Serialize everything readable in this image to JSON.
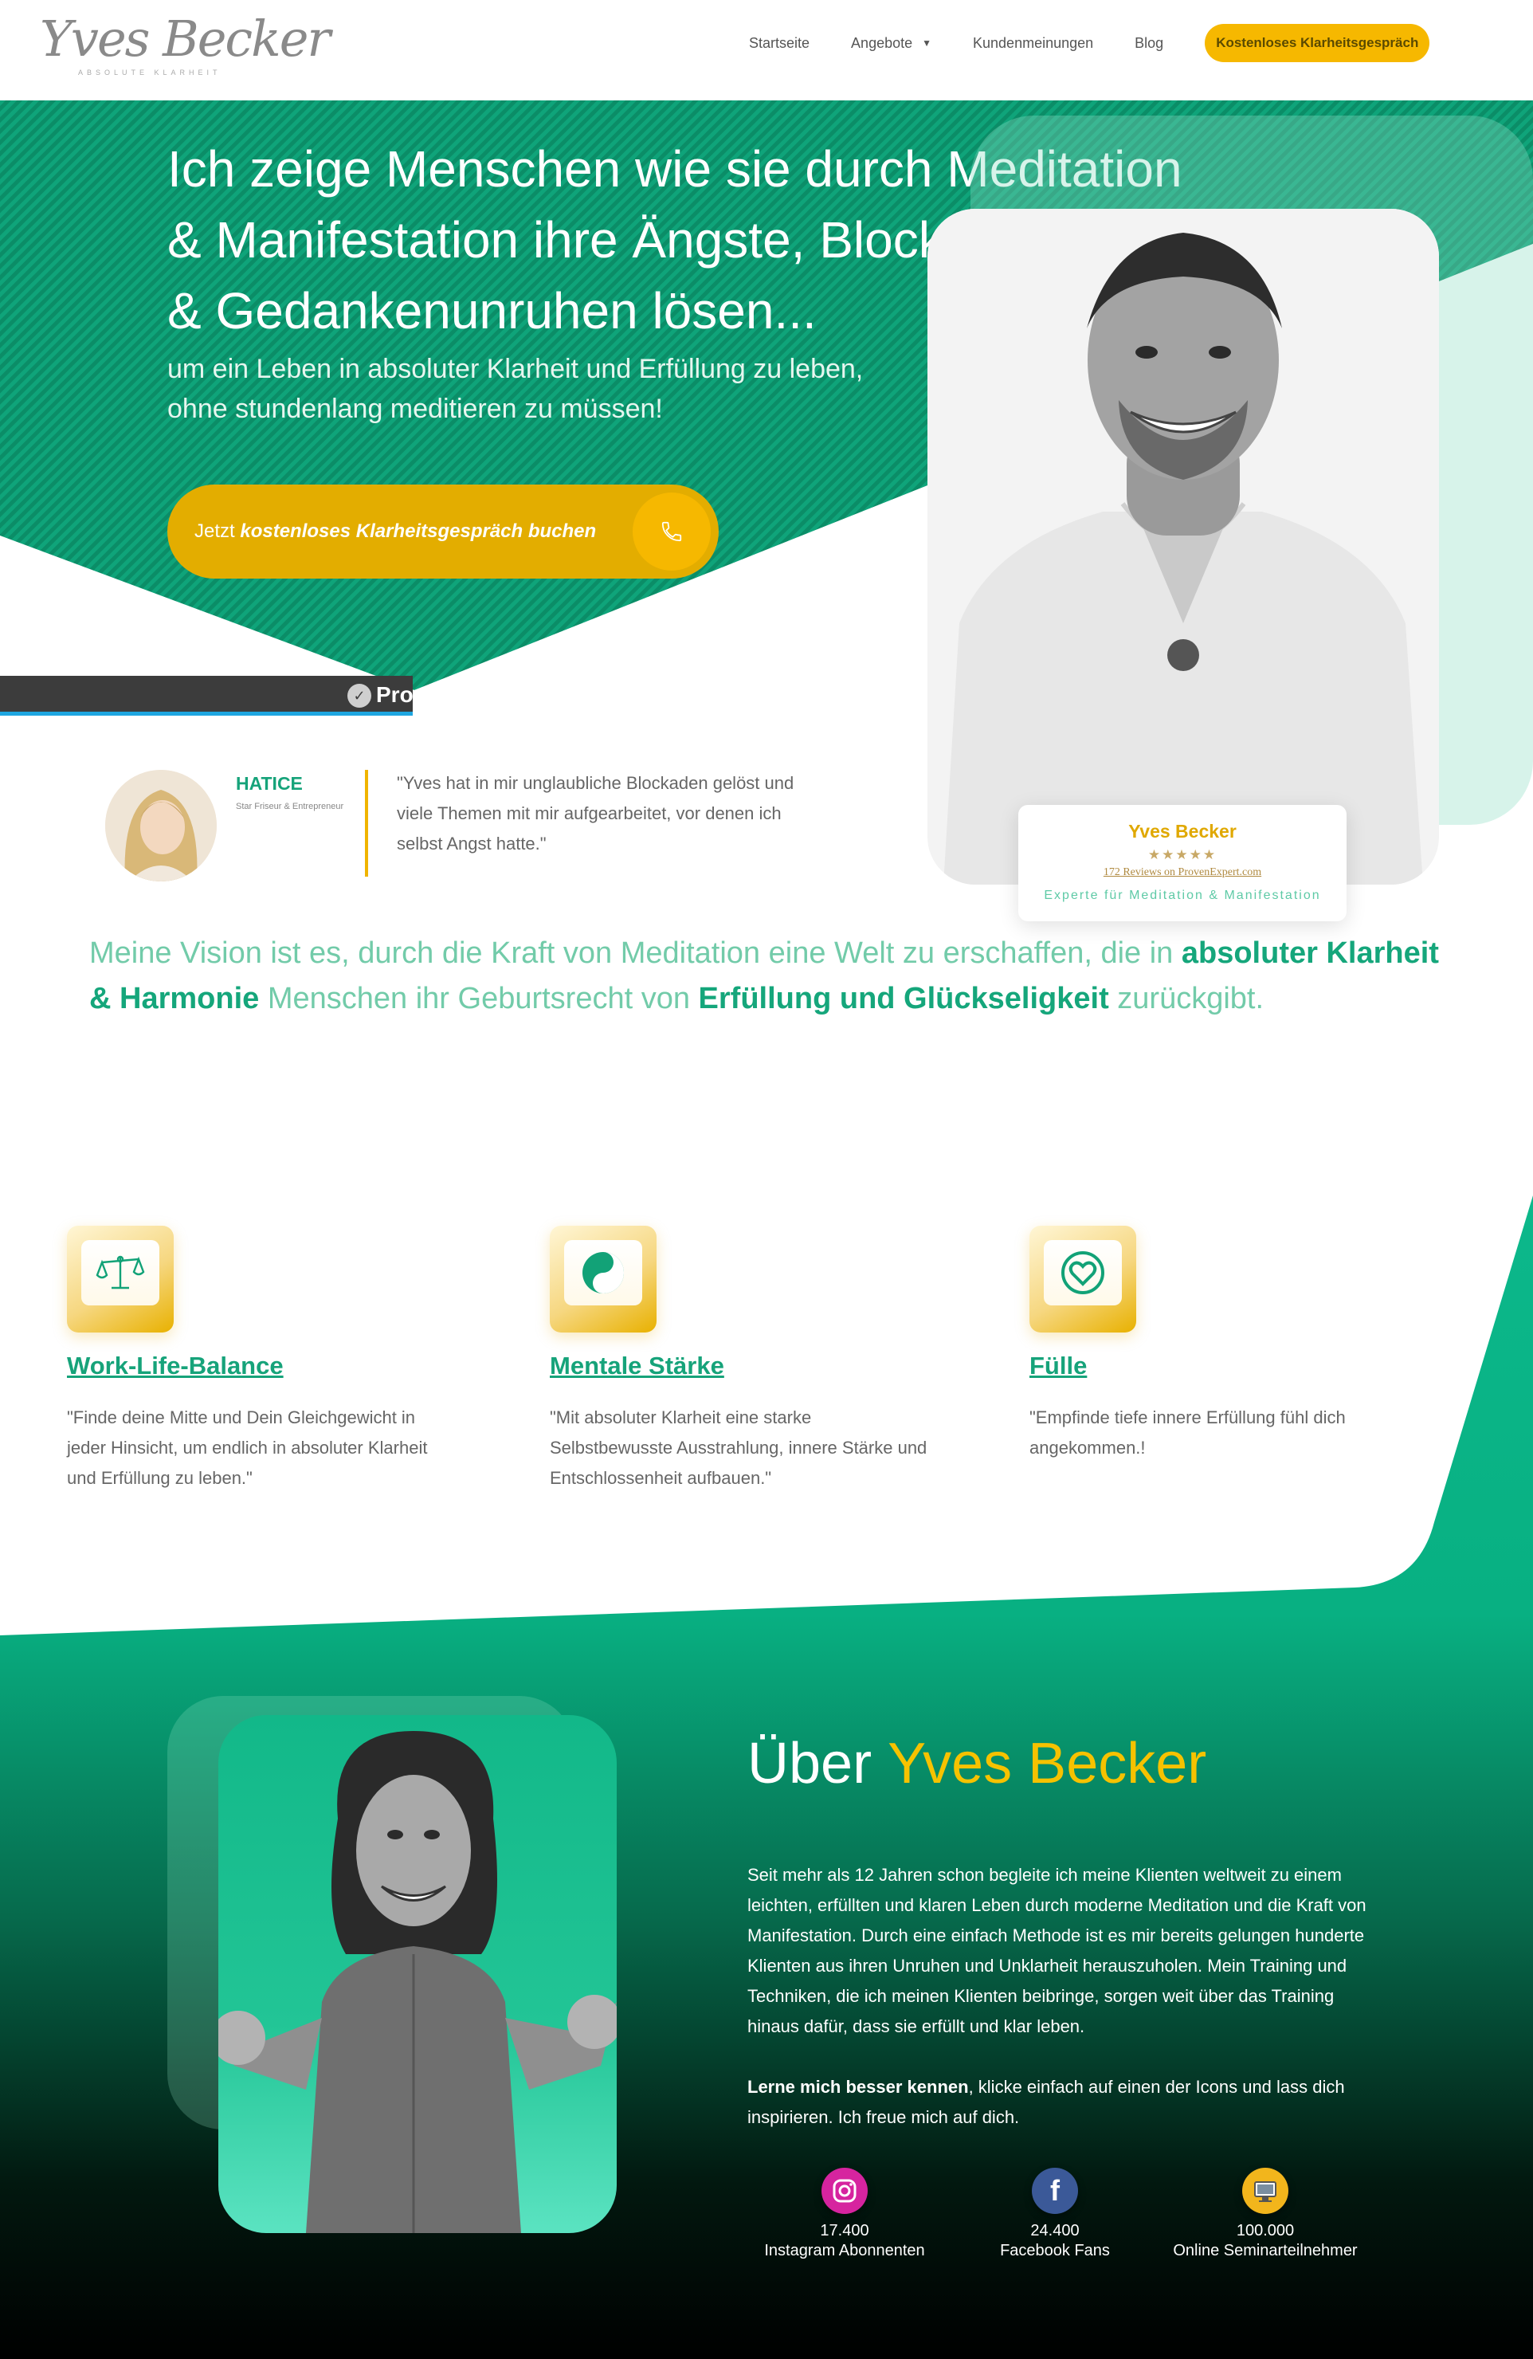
{
  "header": {
    "logo_name": "Yves Becker",
    "logo_tagline": "ABSOLUTE KLARHEIT",
    "nav": [
      "Startseite",
      "Angebote",
      "Kundenmeinungen",
      "Blog"
    ],
    "cta": "Kostenloses Klarheitsgespräch"
  },
  "hero": {
    "title": "Ich zeige Menschen wie sie durch Meditation & Manifestation ihre Ängste, Blockaden Stress & Gedankenunruhen lösen...",
    "subtitle_line1": "um ein Leben in absoluter Klarheit und Erfüllung zu leben,",
    "subtitle_line2": "ohne stundenlang meditieren zu müssen!",
    "cta_prefix": "Jetzt",
    "cta_bold": "kostenloses Klarheitsgespräch buchen",
    "phone_icon": "phone-icon"
  },
  "proven_expert": {
    "bar_text": "Pro",
    "card_name": "Yves Becker",
    "stars": "★★★★★",
    "reviews": "172 Reviews on ProvenExpert.com",
    "role": "Experte für Meditation & Manifestation"
  },
  "testimonial": {
    "name": "HATICE",
    "role": "Star Friseur & Entrepreneur",
    "quote": "\"Yves hat in mir unglaubliche Blockaden gelöst und viele Themen mit mir aufgearbeitet, vor denen ich selbst Angst hatte.\""
  },
  "vision": {
    "part1": "Meine Vision ist es, durch die Kraft von Meditation eine Welt zu erschaffen, die in ",
    "bold1": "absoluter Klarheit & Harmonie",
    "part2": " Menschen ihr Geburtsrecht von ",
    "bold2": "Erfüllung und Glückseligkeit",
    "part3": " zurückgibt."
  },
  "features": [
    {
      "title": "Work-Life-Balance",
      "text": "\"Finde deine Mitte und Dein Gleichgewicht in jeder Hinsicht, um endlich in absoluter Klarheit und Erfüllung zu leben.\"",
      "icon": "scales-icon"
    },
    {
      "title": "Mentale Stärke",
      "text": "\"Mit absoluter Klarheit eine starke Selbstbewusste Ausstrahlung, innere Stärke und Entschlossenheit aufbauen.\"",
      "icon": "yin-yang-icon"
    },
    {
      "title": "Fülle",
      "text": "\"Empfinde tiefe innere Erfüllung fühl dich angekommen.!",
      "icon": "heart-icon"
    }
  ],
  "about": {
    "title_prefix": "Über",
    "title_name": "Yves Becker",
    "text": "Seit mehr als 12 Jahren schon begleite ich meine Klienten weltweit zu einem leichten, erfüllten und klaren Leben durch moderne Meditation und die Kraft von Manifestation. Durch eine einfach Methode ist es mir bereits gelungen hunderte Klienten aus ihren Unruhen und Unklarheit herauszuholen. Mein Training und Techniken, die ich meinen Klienten beibringe, sorgen weit über das Training hinaus dafür, dass sie erfüllt und klar leben.",
    "text2_bold": "Lerne mich besser kennen",
    "text2_rest": ", klicke einfach auf einen der Icons und lass dich inspirieren. Ich freue mich auf dich."
  },
  "stats": [
    {
      "number": "17.400",
      "label": "Instagram Abonnenten",
      "icon": "instagram-icon",
      "color": "#d6249f"
    },
    {
      "number": "24.400",
      "label": "Facebook Fans",
      "icon": "facebook-icon",
      "color": "#3b5998"
    },
    {
      "number": "100.000",
      "label": "Online Seminarteilnehmer",
      "icon": "monitor-icon",
      "color": "#f2b51c"
    }
  ],
  "colors": {
    "primary_green": "#0ab287",
    "accent_yellow": "#f6b800",
    "dark": "#0a0a0a"
  }
}
